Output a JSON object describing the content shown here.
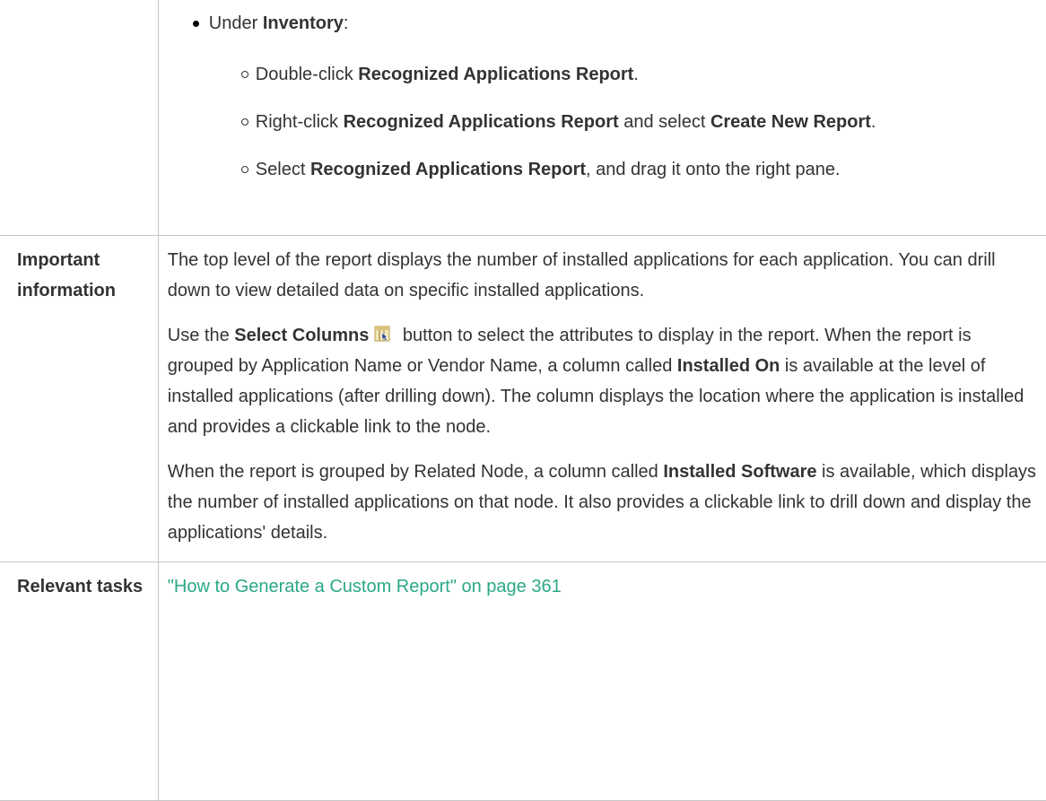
{
  "steps": {
    "intro_prefix": "Under ",
    "intro_bold": "Inventory",
    "intro_suffix": ":",
    "items": [
      {
        "parts": [
          "Double-click ",
          "Recognized Applications Report",
          "."
        ]
      },
      {
        "parts": [
          "Right-click ",
          "Recognized Applications Report",
          " and select ",
          "Create New Report",
          "."
        ]
      },
      {
        "parts": [
          "Select ",
          "Recognized Applications Report",
          ", and drag it onto the right pane."
        ]
      }
    ]
  },
  "important": {
    "label": "Important information",
    "para1": "The top level of the report displays the number of installed applications for each application. You can drill down to view detailed data on specific installed applications.",
    "para2_prefix": "Use the ",
    "para2_bold": "Select Columns",
    "select_columns_icon": "select-columns-icon",
    "para2_suffix": " button to select the attributes to display in the report. When the report is grouped by Application Name or Vendor Name, a column called ",
    "para2_bold2": "Installed On",
    "para2_end": " is available at the level of installed applications (after drilling down). The column displays the location where the application is installed and provides a clickable link to the node.",
    "para3_prefix": "When the report is grouped by Related Node, a column called ",
    "para3_bold": "Installed Software",
    "para3_end": " is available, which displays the number of installed applications on that node. It also provides a clickable link to drill down and display the applications' details."
  },
  "relevant": {
    "label": "Relevant tasks",
    "link": "\"How to Generate a Custom Report\" on page 361"
  },
  "colors": {
    "link": "#2aa887",
    "border": "#c6c6c6",
    "text": "#333333"
  }
}
